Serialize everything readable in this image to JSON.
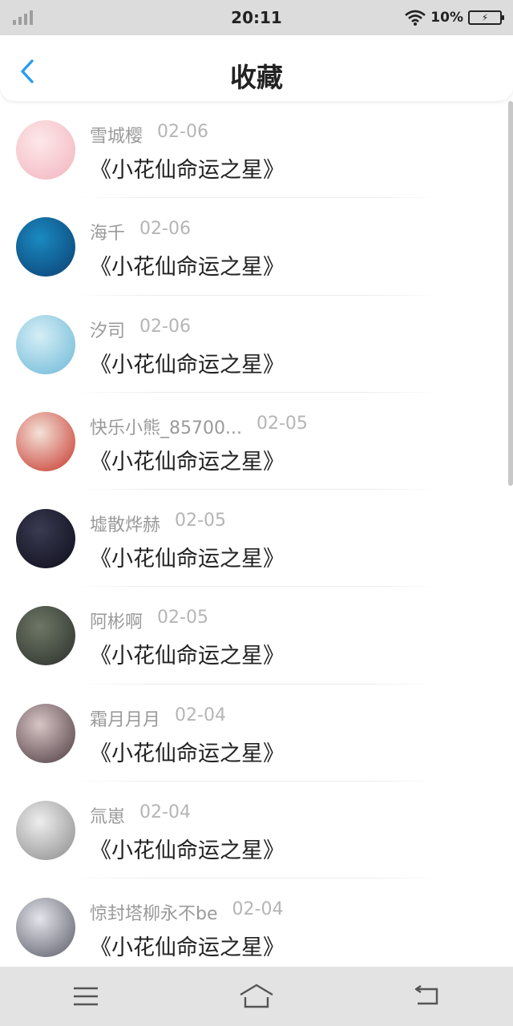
{
  "status_bar": {
    "time": "20:11",
    "battery_percent": "10%",
    "icons": [
      "signal-icon",
      "wifi-icon",
      "battery-charging-icon"
    ]
  },
  "header": {
    "title": "收藏",
    "back_icon": "chevron-left-icon",
    "accent_color": "#2b9cf2"
  },
  "items": [
    {
      "name": "雪城樱",
      "date": "02-06",
      "book": "《小花仙命运之星》",
      "avatar_colors": [
        "#fde8ea",
        "#f2b3bd"
      ]
    },
    {
      "name": "海千",
      "date": "02-06",
      "book": "《小花仙命运之星》",
      "avatar_colors": [
        "#1a8ac0",
        "#0b3f72"
      ]
    },
    {
      "name": "汐司",
      "date": "02-06",
      "book": "《小花仙命运之星》",
      "avatar_colors": [
        "#d6eef6",
        "#6bb8d6"
      ]
    },
    {
      "name": "快乐小熊_85700...",
      "date": "02-05",
      "book": "《小花仙命运之星》",
      "avatar_colors": [
        "#f3e2d8",
        "#c7342a"
      ]
    },
    {
      "name": "墟散烨赫",
      "date": "02-05",
      "book": "《小花仙命运之星》",
      "avatar_colors": [
        "#3a3a52",
        "#0d0d1a"
      ]
    },
    {
      "name": "阿彬啊",
      "date": "02-05",
      "book": "《小花仙命运之星》",
      "avatar_colors": [
        "#6e7766",
        "#2a2f2a"
      ]
    },
    {
      "name": "霜月月月",
      "date": "02-04",
      "book": "《小花仙命运之星》",
      "avatar_colors": [
        "#d8c4c4",
        "#4a3a40"
      ]
    },
    {
      "name": "氚崽",
      "date": "02-04",
      "book": "《小花仙命运之星》",
      "avatar_colors": [
        "#eeeeee",
        "#8a8a8a"
      ]
    },
    {
      "name": "惊封塔柳永不be",
      "date": "02-04",
      "book": "《小花仙命运之星》",
      "avatar_colors": [
        "#e4e4ec",
        "#5a5a66"
      ]
    }
  ],
  "nav_bar": {
    "icons": [
      "menu-icon",
      "home-icon",
      "back-icon"
    ]
  }
}
